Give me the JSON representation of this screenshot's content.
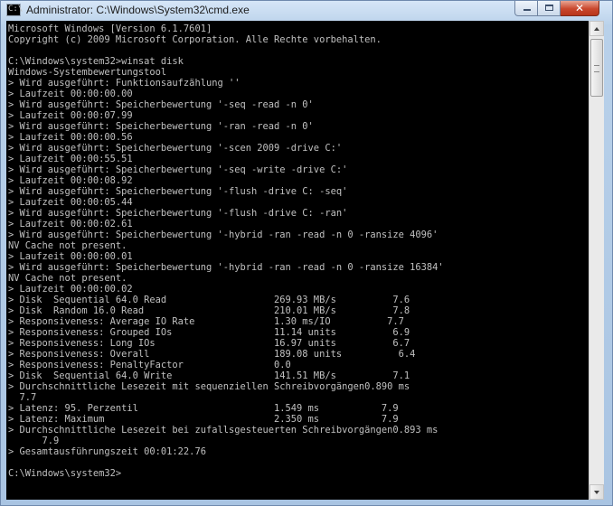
{
  "window": {
    "title": "Administrator: C:\\Windows\\System32\\cmd.exe",
    "icon": "cmd-icon",
    "icon_text": "C:\\",
    "buttons": {
      "minimize_icon": "minimize-icon",
      "maximize_icon": "maximize-icon",
      "close_icon": "close-icon",
      "close_glyph": "✕"
    }
  },
  "console": {
    "background_color": "#000000",
    "text_color": "#c0c0c0",
    "lines": [
      "Microsoft Windows [Version 6.1.7601]",
      "Copyright (c) 2009 Microsoft Corporation. Alle Rechte vorbehalten.",
      "",
      "C:\\Windows\\system32>winsat disk",
      "Windows-Systembewertungstool",
      "> Wird ausgeführt: Funktionsaufzählung ''",
      "> Laufzeit 00:00:00.00",
      "> Wird ausgeführt: Speicherbewertung '-seq -read -n 0'",
      "> Laufzeit 00:00:07.99",
      "> Wird ausgeführt: Speicherbewertung '-ran -read -n 0'",
      "> Laufzeit 00:00:00.56",
      "> Wird ausgeführt: Speicherbewertung '-scen 2009 -drive C:'",
      "> Laufzeit 00:00:55.51",
      "> Wird ausgeführt: Speicherbewertung '-seq -write -drive C:'",
      "> Laufzeit 00:00:08.92",
      "> Wird ausgeführt: Speicherbewertung '-flush -drive C: -seq'",
      "> Laufzeit 00:00:05.44",
      "> Wird ausgeführt: Speicherbewertung '-flush -drive C: -ran'",
      "> Laufzeit 00:00:02.61",
      "> Wird ausgeführt: Speicherbewertung '-hybrid -ran -read -n 0 -ransize 4096'",
      "NV Cache not present.",
      "> Laufzeit 00:00:00.01",
      "> Wird ausgeführt: Speicherbewertung '-hybrid -ran -read -n 0 -ransize 16384'",
      "NV Cache not present.",
      "> Laufzeit 00:00:00.02",
      "> Disk  Sequential 64.0 Read                   269.93 MB/s          7.6",
      "> Disk  Random 16.0 Read                       210.01 MB/s          7.8",
      "> Responsiveness: Average IO Rate              1.30 ms/IO          7.7",
      "> Responsiveness: Grouped IOs                  11.14 units          6.9",
      "> Responsiveness: Long IOs                     16.97 units          6.7",
      "> Responsiveness: Overall                      189.08 units          6.4",
      "> Responsiveness: PenaltyFactor                0.0",
      "> Disk  Sequential 64.0 Write                  141.51 MB/s          7.1",
      "> Durchschnittliche Lesezeit mit sequenziellen Schreibvorgängen0.890 ms",
      "  7.7",
      "> Latenz: 95. Perzentil                        1.549 ms           7.9",
      "> Latenz: Maximum                              2.350 ms           7.9",
      "> Durchschnittliche Lesezeit bei zufallsgesteuerten Schreibvorgängen0.893 ms",
      "      7.9",
      "> Gesamtausführungszeit 00:01:22.76",
      "",
      "C:\\Windows\\system32>"
    ]
  },
  "scrollbar": {
    "up_icon": "scroll-up-arrow-icon",
    "down_icon": "scroll-down-arrow-icon"
  }
}
